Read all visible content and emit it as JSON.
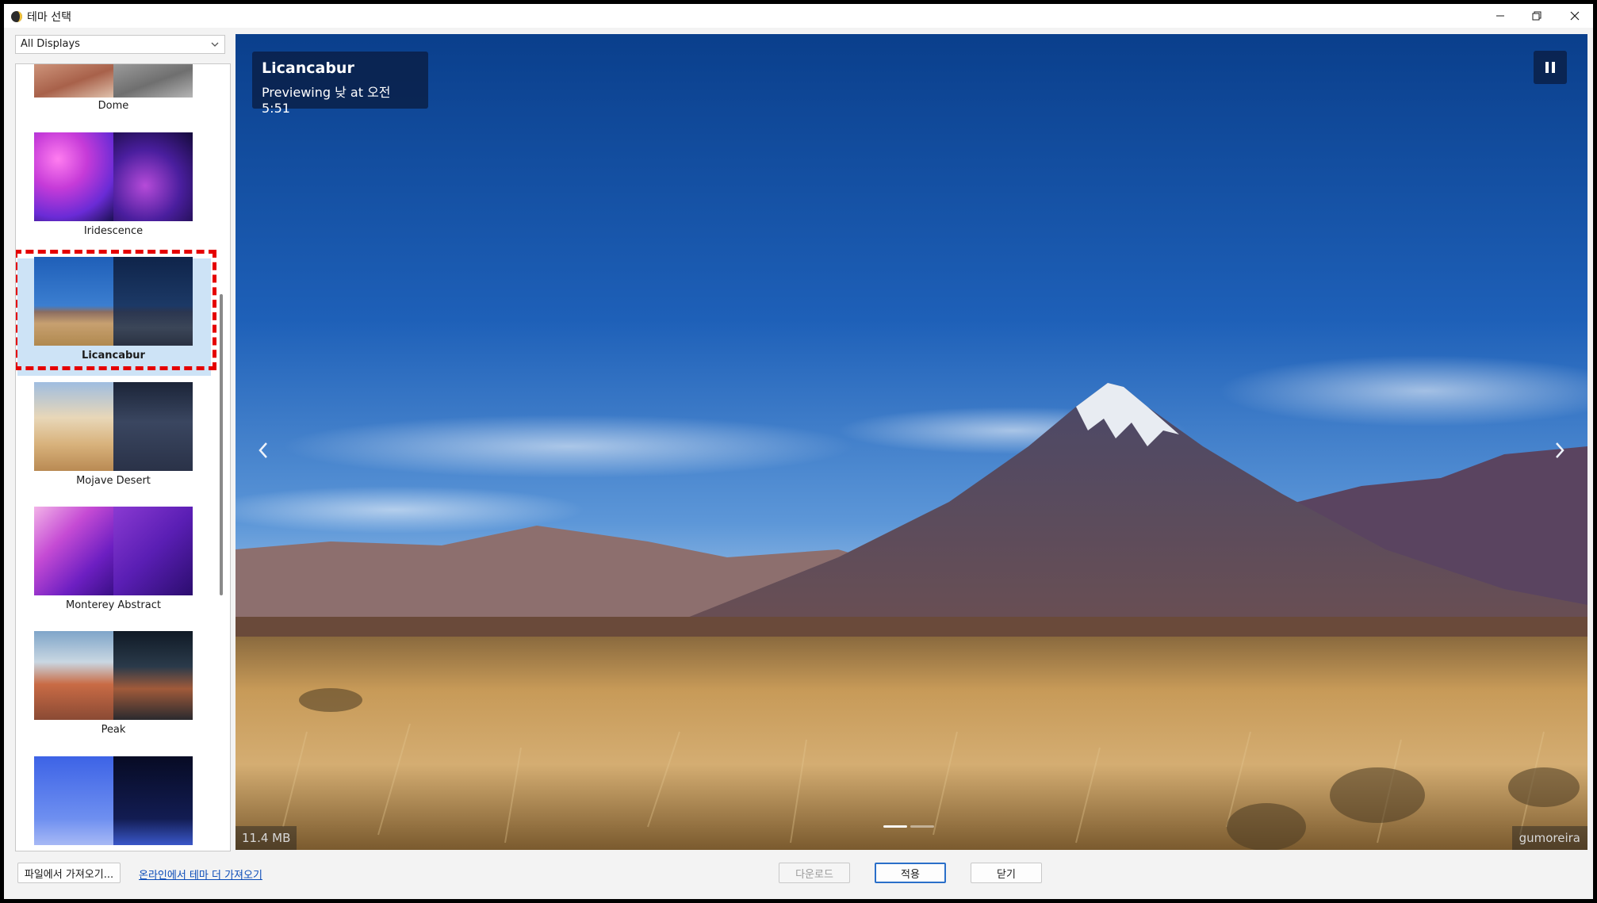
{
  "window": {
    "title": "테마 선택",
    "controls": {
      "minimize": "minimize-icon",
      "restore": "restore-icon",
      "close": "close-icon"
    }
  },
  "sidebar": {
    "display_select": {
      "value": "All Displays"
    },
    "themes": [
      {
        "name": "Dome",
        "colors": [
          "#b87a5c",
          "#8d8d8d"
        ]
      },
      {
        "name": "Iridescence",
        "colors": [
          "#c63bd8",
          "#2a1a6e"
        ]
      },
      {
        "name": "Licancabur",
        "colors": [
          "#2d70c8",
          "#16315e"
        ],
        "selected": true
      },
      {
        "name": "Mojave Desert",
        "colors": [
          "#d8b27c",
          "#2a3248"
        ]
      },
      {
        "name": "Monterey Abstract",
        "colors": [
          "#9a3ad0",
          "#4b1aa0"
        ]
      },
      {
        "name": "Peak",
        "colors": [
          "#c96b45",
          "#1c2836"
        ]
      },
      {
        "name": "",
        "colors": [
          "#4d74e8",
          "#0e1438"
        ]
      }
    ]
  },
  "preview": {
    "title": "Licancabur",
    "subtitle": "Previewing 낮 at 오전 5:51",
    "size": "11.4 MB",
    "credit": "gumoreira",
    "slide_count": 2,
    "active_slide": 0
  },
  "footer": {
    "import_file": "파일에서 가져오기...",
    "online_link": "온라인에서 테마 더 가져오기",
    "download": "다운로드",
    "apply": "적용",
    "close": "닫기"
  },
  "colors": {
    "selection_highlight": "#cde3f6",
    "annotation_dash": "#e50000",
    "primary_border": "#2a6fc9"
  }
}
